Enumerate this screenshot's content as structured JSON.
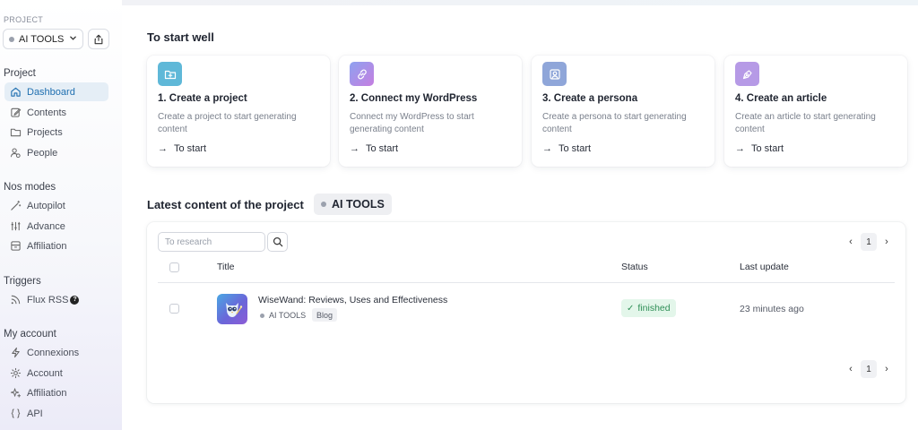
{
  "sidebar": {
    "project_label": "PROJECT",
    "project_select": "AI TOOLS",
    "sections": [
      {
        "title": "Project",
        "items": [
          {
            "label": "Dashboard",
            "icon": "home-icon",
            "active": true
          },
          {
            "label": "Contents",
            "icon": "edit-icon"
          },
          {
            "label": "Projects",
            "icon": "folder-icon"
          },
          {
            "label": "People",
            "icon": "people-icon"
          }
        ]
      },
      {
        "title": "Nos modes",
        "items": [
          {
            "label": "Autopilot",
            "icon": "wand-icon"
          },
          {
            "label": "Advance",
            "icon": "sliders-icon"
          },
          {
            "label": "Affiliation",
            "icon": "archive-icon"
          }
        ]
      },
      {
        "title": "Triggers",
        "items": [
          {
            "label": "Flux RSS",
            "icon": "rss-icon",
            "help": "?"
          }
        ]
      },
      {
        "title": "My account",
        "items": [
          {
            "label": "Connexions",
            "icon": "bolt-icon"
          },
          {
            "label": "Account",
            "icon": "gear-icon"
          },
          {
            "label": "Affiliation",
            "icon": "sparkle-icon"
          },
          {
            "label": "API",
            "icon": "braces-icon"
          }
        ]
      }
    ]
  },
  "start": {
    "title": "To start well",
    "cards": [
      {
        "title": "1. Create a project",
        "desc": "Create a project to start generating content",
        "action": "To start",
        "icon": "folder-plus-icon",
        "color": "#5fb8d8"
      },
      {
        "title": "2. Connect my WordPress",
        "desc": "Connect my WordPress to start generating content",
        "action": "To start",
        "icon": "link-icon",
        "color": "#a98be8"
      },
      {
        "title": "3. Create a persona",
        "desc": "Create a persona to start generating content",
        "action": "To start",
        "icon": "user-square-icon",
        "color": "#8fa6d9"
      },
      {
        "title": "4. Create an article",
        "desc": "Create an article to start generating content",
        "action": "To start",
        "icon": "pen-tool-icon",
        "color": "#b69ae6"
      }
    ]
  },
  "latest": {
    "title": "Latest content of the project",
    "project_chip": "AI TOOLS",
    "search_placeholder": "To research",
    "page": "1",
    "columns": {
      "title": "Title",
      "status": "Status",
      "updated": "Last update"
    },
    "rows": [
      {
        "title": "WiseWand: Reviews, Uses and Effectiveness",
        "project": "AI TOOLS",
        "tag": "Blog",
        "status": "finished",
        "updated": "23 minutes ago"
      }
    ]
  }
}
